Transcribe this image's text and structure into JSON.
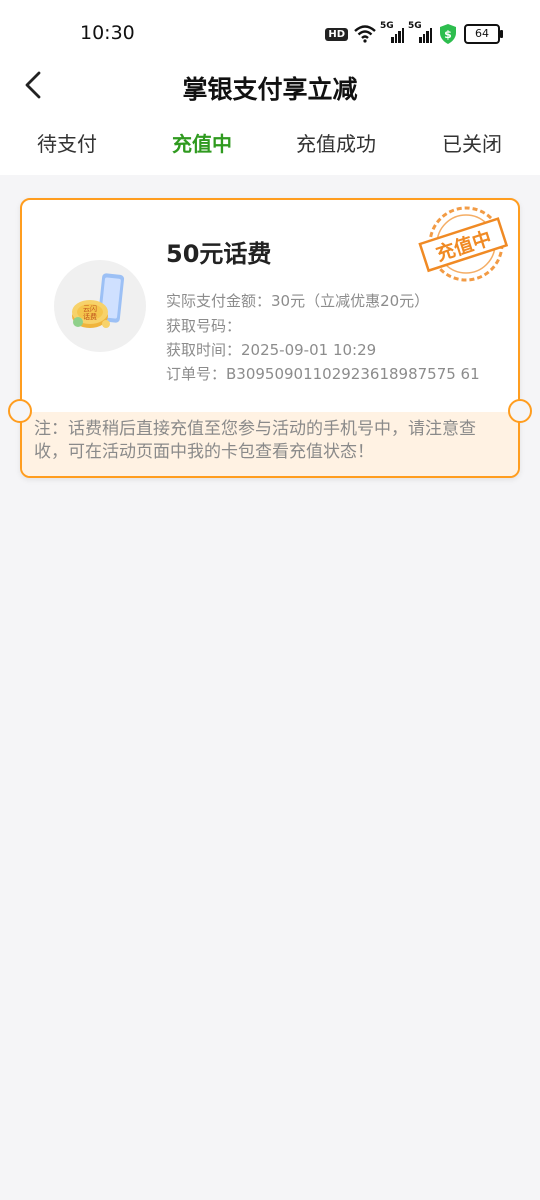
{
  "status_bar": {
    "time": "10:30",
    "hd_label": "HD",
    "net_label_1": "5G",
    "net_label_2": "5G",
    "battery": "64"
  },
  "header": {
    "title": "掌银支付享立减"
  },
  "tabs": [
    {
      "label": "待支付",
      "active": false
    },
    {
      "label": "充值中",
      "active": true
    },
    {
      "label": "充值成功",
      "active": false
    },
    {
      "label": "已关闭",
      "active": false
    }
  ],
  "order": {
    "product_name": "50元话费",
    "coin_text_1": "云闪",
    "coin_text_2": "话费",
    "actual_pay": "实际支付金额：30元（立减优惠20元）",
    "phone_label": "获取号码：",
    "time": "获取时间：2025-09-01 10:29",
    "order_no": "订单号：B30950901102923618987575 61",
    "stamp_text": "充值中",
    "note": "注：话费稍后直接充值至您参与活动的手机号中，请注意查收，可在活动页面中我的卡包查看充值状态！"
  },
  "colors": {
    "accent_green": "#2f9a1f",
    "card_border": "#ff9d1f",
    "stamp": "#f08a24",
    "note_bg": "#fff2e3"
  }
}
